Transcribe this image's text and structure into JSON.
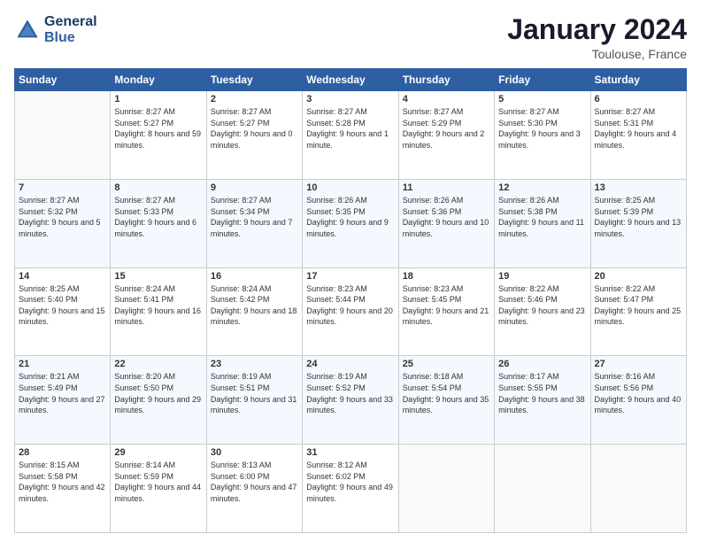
{
  "logo": {
    "line1": "General",
    "line2": "Blue"
  },
  "title": "January 2024",
  "subtitle": "Toulouse, France",
  "header_days": [
    "Sunday",
    "Monday",
    "Tuesday",
    "Wednesday",
    "Thursday",
    "Friday",
    "Saturday"
  ],
  "weeks": [
    [
      {
        "day": "",
        "sunrise": "",
        "sunset": "",
        "daylight": ""
      },
      {
        "day": "1",
        "sunrise": "Sunrise: 8:27 AM",
        "sunset": "Sunset: 5:27 PM",
        "daylight": "Daylight: 8 hours and 59 minutes."
      },
      {
        "day": "2",
        "sunrise": "Sunrise: 8:27 AM",
        "sunset": "Sunset: 5:27 PM",
        "daylight": "Daylight: 9 hours and 0 minutes."
      },
      {
        "day": "3",
        "sunrise": "Sunrise: 8:27 AM",
        "sunset": "Sunset: 5:28 PM",
        "daylight": "Daylight: 9 hours and 1 minute."
      },
      {
        "day": "4",
        "sunrise": "Sunrise: 8:27 AM",
        "sunset": "Sunset: 5:29 PM",
        "daylight": "Daylight: 9 hours and 2 minutes."
      },
      {
        "day": "5",
        "sunrise": "Sunrise: 8:27 AM",
        "sunset": "Sunset: 5:30 PM",
        "daylight": "Daylight: 9 hours and 3 minutes."
      },
      {
        "day": "6",
        "sunrise": "Sunrise: 8:27 AM",
        "sunset": "Sunset: 5:31 PM",
        "daylight": "Daylight: 9 hours and 4 minutes."
      }
    ],
    [
      {
        "day": "7",
        "sunrise": "Sunrise: 8:27 AM",
        "sunset": "Sunset: 5:32 PM",
        "daylight": "Daylight: 9 hours and 5 minutes."
      },
      {
        "day": "8",
        "sunrise": "Sunrise: 8:27 AM",
        "sunset": "Sunset: 5:33 PM",
        "daylight": "Daylight: 9 hours and 6 minutes."
      },
      {
        "day": "9",
        "sunrise": "Sunrise: 8:27 AM",
        "sunset": "Sunset: 5:34 PM",
        "daylight": "Daylight: 9 hours and 7 minutes."
      },
      {
        "day": "10",
        "sunrise": "Sunrise: 8:26 AM",
        "sunset": "Sunset: 5:35 PM",
        "daylight": "Daylight: 9 hours and 9 minutes."
      },
      {
        "day": "11",
        "sunrise": "Sunrise: 8:26 AM",
        "sunset": "Sunset: 5:36 PM",
        "daylight": "Daylight: 9 hours and 10 minutes."
      },
      {
        "day": "12",
        "sunrise": "Sunrise: 8:26 AM",
        "sunset": "Sunset: 5:38 PM",
        "daylight": "Daylight: 9 hours and 11 minutes."
      },
      {
        "day": "13",
        "sunrise": "Sunrise: 8:25 AM",
        "sunset": "Sunset: 5:39 PM",
        "daylight": "Daylight: 9 hours and 13 minutes."
      }
    ],
    [
      {
        "day": "14",
        "sunrise": "Sunrise: 8:25 AM",
        "sunset": "Sunset: 5:40 PM",
        "daylight": "Daylight: 9 hours and 15 minutes."
      },
      {
        "day": "15",
        "sunrise": "Sunrise: 8:24 AM",
        "sunset": "Sunset: 5:41 PM",
        "daylight": "Daylight: 9 hours and 16 minutes."
      },
      {
        "day": "16",
        "sunrise": "Sunrise: 8:24 AM",
        "sunset": "Sunset: 5:42 PM",
        "daylight": "Daylight: 9 hours and 18 minutes."
      },
      {
        "day": "17",
        "sunrise": "Sunrise: 8:23 AM",
        "sunset": "Sunset: 5:44 PM",
        "daylight": "Daylight: 9 hours and 20 minutes."
      },
      {
        "day": "18",
        "sunrise": "Sunrise: 8:23 AM",
        "sunset": "Sunset: 5:45 PM",
        "daylight": "Daylight: 9 hours and 21 minutes."
      },
      {
        "day": "19",
        "sunrise": "Sunrise: 8:22 AM",
        "sunset": "Sunset: 5:46 PM",
        "daylight": "Daylight: 9 hours and 23 minutes."
      },
      {
        "day": "20",
        "sunrise": "Sunrise: 8:22 AM",
        "sunset": "Sunset: 5:47 PM",
        "daylight": "Daylight: 9 hours and 25 minutes."
      }
    ],
    [
      {
        "day": "21",
        "sunrise": "Sunrise: 8:21 AM",
        "sunset": "Sunset: 5:49 PM",
        "daylight": "Daylight: 9 hours and 27 minutes."
      },
      {
        "day": "22",
        "sunrise": "Sunrise: 8:20 AM",
        "sunset": "Sunset: 5:50 PM",
        "daylight": "Daylight: 9 hours and 29 minutes."
      },
      {
        "day": "23",
        "sunrise": "Sunrise: 8:19 AM",
        "sunset": "Sunset: 5:51 PM",
        "daylight": "Daylight: 9 hours and 31 minutes."
      },
      {
        "day": "24",
        "sunrise": "Sunrise: 8:19 AM",
        "sunset": "Sunset: 5:52 PM",
        "daylight": "Daylight: 9 hours and 33 minutes."
      },
      {
        "day": "25",
        "sunrise": "Sunrise: 8:18 AM",
        "sunset": "Sunset: 5:54 PM",
        "daylight": "Daylight: 9 hours and 35 minutes."
      },
      {
        "day": "26",
        "sunrise": "Sunrise: 8:17 AM",
        "sunset": "Sunset: 5:55 PM",
        "daylight": "Daylight: 9 hours and 38 minutes."
      },
      {
        "day": "27",
        "sunrise": "Sunrise: 8:16 AM",
        "sunset": "Sunset: 5:56 PM",
        "daylight": "Daylight: 9 hours and 40 minutes."
      }
    ],
    [
      {
        "day": "28",
        "sunrise": "Sunrise: 8:15 AM",
        "sunset": "Sunset: 5:58 PM",
        "daylight": "Daylight: 9 hours and 42 minutes."
      },
      {
        "day": "29",
        "sunrise": "Sunrise: 8:14 AM",
        "sunset": "Sunset: 5:59 PM",
        "daylight": "Daylight: 9 hours and 44 minutes."
      },
      {
        "day": "30",
        "sunrise": "Sunrise: 8:13 AM",
        "sunset": "Sunset: 6:00 PM",
        "daylight": "Daylight: 9 hours and 47 minutes."
      },
      {
        "day": "31",
        "sunrise": "Sunrise: 8:12 AM",
        "sunset": "Sunset: 6:02 PM",
        "daylight": "Daylight: 9 hours and 49 minutes."
      },
      {
        "day": "",
        "sunrise": "",
        "sunset": "",
        "daylight": ""
      },
      {
        "day": "",
        "sunrise": "",
        "sunset": "",
        "daylight": ""
      },
      {
        "day": "",
        "sunrise": "",
        "sunset": "",
        "daylight": ""
      }
    ]
  ]
}
